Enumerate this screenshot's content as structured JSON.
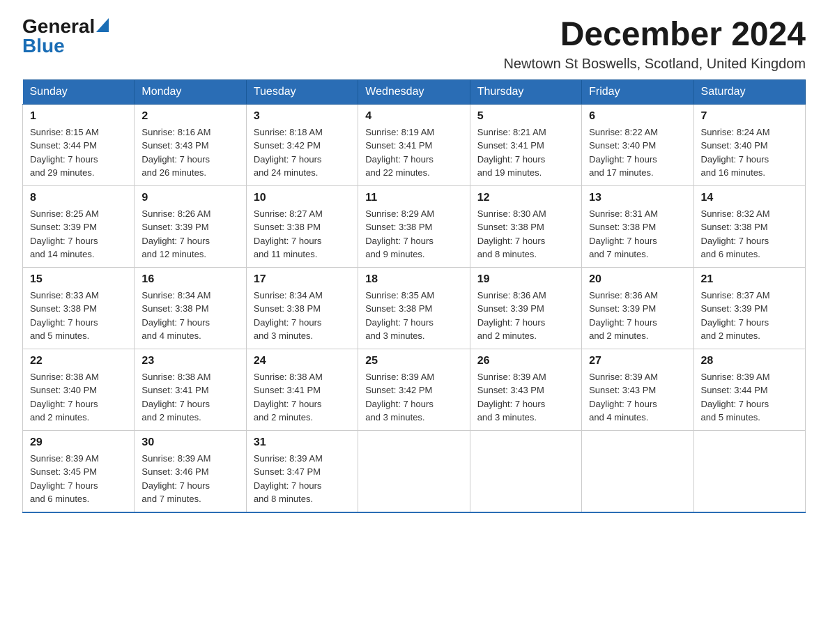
{
  "header": {
    "logo_general": "General",
    "logo_blue": "Blue",
    "month_year": "December 2024",
    "location": "Newtown St Boswells, Scotland, United Kingdom"
  },
  "weekdays": [
    "Sunday",
    "Monday",
    "Tuesday",
    "Wednesday",
    "Thursday",
    "Friday",
    "Saturday"
  ],
  "weeks": [
    [
      {
        "day": "1",
        "sunrise": "8:15 AM",
        "sunset": "3:44 PM",
        "daylight": "7 hours and 29 minutes."
      },
      {
        "day": "2",
        "sunrise": "8:16 AM",
        "sunset": "3:43 PM",
        "daylight": "7 hours and 26 minutes."
      },
      {
        "day": "3",
        "sunrise": "8:18 AM",
        "sunset": "3:42 PM",
        "daylight": "7 hours and 24 minutes."
      },
      {
        "day": "4",
        "sunrise": "8:19 AM",
        "sunset": "3:41 PM",
        "daylight": "7 hours and 22 minutes."
      },
      {
        "day": "5",
        "sunrise": "8:21 AM",
        "sunset": "3:41 PM",
        "daylight": "7 hours and 19 minutes."
      },
      {
        "day": "6",
        "sunrise": "8:22 AM",
        "sunset": "3:40 PM",
        "daylight": "7 hours and 17 minutes."
      },
      {
        "day": "7",
        "sunrise": "8:24 AM",
        "sunset": "3:40 PM",
        "daylight": "7 hours and 16 minutes."
      }
    ],
    [
      {
        "day": "8",
        "sunrise": "8:25 AM",
        "sunset": "3:39 PM",
        "daylight": "7 hours and 14 minutes."
      },
      {
        "day": "9",
        "sunrise": "8:26 AM",
        "sunset": "3:39 PM",
        "daylight": "7 hours and 12 minutes."
      },
      {
        "day": "10",
        "sunrise": "8:27 AM",
        "sunset": "3:38 PM",
        "daylight": "7 hours and 11 minutes."
      },
      {
        "day": "11",
        "sunrise": "8:29 AM",
        "sunset": "3:38 PM",
        "daylight": "7 hours and 9 minutes."
      },
      {
        "day": "12",
        "sunrise": "8:30 AM",
        "sunset": "3:38 PM",
        "daylight": "7 hours and 8 minutes."
      },
      {
        "day": "13",
        "sunrise": "8:31 AM",
        "sunset": "3:38 PM",
        "daylight": "7 hours and 7 minutes."
      },
      {
        "day": "14",
        "sunrise": "8:32 AM",
        "sunset": "3:38 PM",
        "daylight": "7 hours and 6 minutes."
      }
    ],
    [
      {
        "day": "15",
        "sunrise": "8:33 AM",
        "sunset": "3:38 PM",
        "daylight": "7 hours and 5 minutes."
      },
      {
        "day": "16",
        "sunrise": "8:34 AM",
        "sunset": "3:38 PM",
        "daylight": "7 hours and 4 minutes."
      },
      {
        "day": "17",
        "sunrise": "8:34 AM",
        "sunset": "3:38 PM",
        "daylight": "7 hours and 3 minutes."
      },
      {
        "day": "18",
        "sunrise": "8:35 AM",
        "sunset": "3:38 PM",
        "daylight": "7 hours and 3 minutes."
      },
      {
        "day": "19",
        "sunrise": "8:36 AM",
        "sunset": "3:39 PM",
        "daylight": "7 hours and 2 minutes."
      },
      {
        "day": "20",
        "sunrise": "8:36 AM",
        "sunset": "3:39 PM",
        "daylight": "7 hours and 2 minutes."
      },
      {
        "day": "21",
        "sunrise": "8:37 AM",
        "sunset": "3:39 PM",
        "daylight": "7 hours and 2 minutes."
      }
    ],
    [
      {
        "day": "22",
        "sunrise": "8:38 AM",
        "sunset": "3:40 PM",
        "daylight": "7 hours and 2 minutes."
      },
      {
        "day": "23",
        "sunrise": "8:38 AM",
        "sunset": "3:41 PM",
        "daylight": "7 hours and 2 minutes."
      },
      {
        "day": "24",
        "sunrise": "8:38 AM",
        "sunset": "3:41 PM",
        "daylight": "7 hours and 2 minutes."
      },
      {
        "day": "25",
        "sunrise": "8:39 AM",
        "sunset": "3:42 PM",
        "daylight": "7 hours and 3 minutes."
      },
      {
        "day": "26",
        "sunrise": "8:39 AM",
        "sunset": "3:43 PM",
        "daylight": "7 hours and 3 minutes."
      },
      {
        "day": "27",
        "sunrise": "8:39 AM",
        "sunset": "3:43 PM",
        "daylight": "7 hours and 4 minutes."
      },
      {
        "day": "28",
        "sunrise": "8:39 AM",
        "sunset": "3:44 PM",
        "daylight": "7 hours and 5 minutes."
      }
    ],
    [
      {
        "day": "29",
        "sunrise": "8:39 AM",
        "sunset": "3:45 PM",
        "daylight": "7 hours and 6 minutes."
      },
      {
        "day": "30",
        "sunrise": "8:39 AM",
        "sunset": "3:46 PM",
        "daylight": "7 hours and 7 minutes."
      },
      {
        "day": "31",
        "sunrise": "8:39 AM",
        "sunset": "3:47 PM",
        "daylight": "7 hours and 8 minutes."
      },
      null,
      null,
      null,
      null
    ]
  ],
  "labels": {
    "sunrise": "Sunrise:",
    "sunset": "Sunset:",
    "daylight": "Daylight:"
  }
}
